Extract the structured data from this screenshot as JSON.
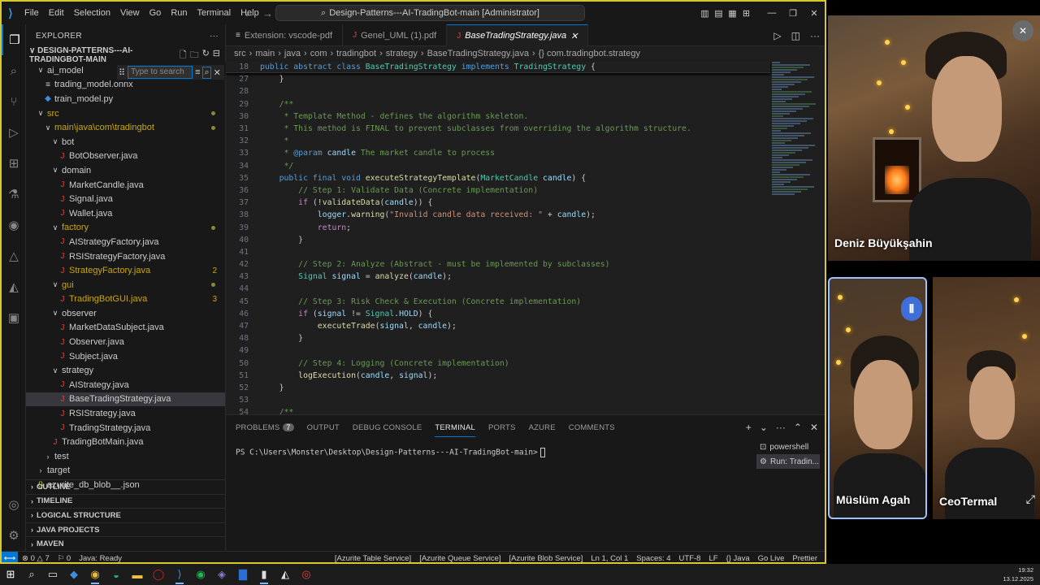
{
  "menu": [
    "File",
    "Edit",
    "Selection",
    "View",
    "Go",
    "Run",
    "Terminal",
    "Help"
  ],
  "command_center": "Design-Patterns---AI-TradingBot-main [Administrator]",
  "explorer": {
    "title": "EXPLORER",
    "root": "DESIGN-PATTERNS---AI-TRADINGBOT-MAIN",
    "search_placeholder": "Type to search",
    "rows": [
      {
        "label": "ai_model",
        "indent": 1,
        "kind": "folder-open",
        "color": "#cccccc"
      },
      {
        "label": "trading_model.onnx",
        "indent": 2,
        "kind": "file",
        "icon": "≡",
        "color": "#cccccc"
      },
      {
        "label": "train_model.py",
        "indent": 2,
        "kind": "file",
        "icon": "◆",
        "iconColor": "#3b8fe0",
        "color": "#cccccc"
      },
      {
        "label": "src",
        "indent": 1,
        "kind": "folder-open",
        "color": "#cca700",
        "dot": true
      },
      {
        "label": "main\\java\\com\\tradingbot",
        "indent": 2,
        "kind": "folder-open",
        "color": "#cca700",
        "dot": true
      },
      {
        "label": "bot",
        "indent": 3,
        "kind": "folder-open",
        "color": "#cccccc"
      },
      {
        "label": "BotObserver.java",
        "indent": 4,
        "kind": "file",
        "icon": "J",
        "iconColor": "#e04040",
        "color": "#cccccc"
      },
      {
        "label": "domain",
        "indent": 3,
        "kind": "folder-open",
        "color": "#cccccc"
      },
      {
        "label": "MarketCandle.java",
        "indent": 4,
        "kind": "file",
        "icon": "J",
        "iconColor": "#e04040",
        "color": "#cccccc"
      },
      {
        "label": "Signal.java",
        "indent": 4,
        "kind": "file",
        "icon": "J",
        "iconColor": "#e04040",
        "color": "#cccccc"
      },
      {
        "label": "Wallet.java",
        "indent": 4,
        "kind": "file",
        "icon": "J",
        "iconColor": "#e04040",
        "color": "#cccccc"
      },
      {
        "label": "factory",
        "indent": 3,
        "kind": "folder-open",
        "color": "#cca700",
        "dot": true
      },
      {
        "label": "AIStrategyFactory.java",
        "indent": 4,
        "kind": "file",
        "icon": "J",
        "iconColor": "#e04040",
        "color": "#cccccc"
      },
      {
        "label": "RSIStrategyFactory.java",
        "indent": 4,
        "kind": "file",
        "icon": "J",
        "iconColor": "#e04040",
        "color": "#cccccc"
      },
      {
        "label": "StrategyFactory.java",
        "indent": 4,
        "kind": "file",
        "icon": "J",
        "iconColor": "#e04040",
        "color": "#cca700",
        "badge": "2"
      },
      {
        "label": "gui",
        "indent": 3,
        "kind": "folder-open",
        "color": "#cca700",
        "dot": true
      },
      {
        "label": "TradingBotGUI.java",
        "indent": 4,
        "kind": "file",
        "icon": "J",
        "iconColor": "#e04040",
        "color": "#cca700",
        "badge": "3"
      },
      {
        "label": "observer",
        "indent": 3,
        "kind": "folder-open",
        "color": "#cccccc"
      },
      {
        "label": "MarketDataSubject.java",
        "indent": 4,
        "kind": "file",
        "icon": "J",
        "iconColor": "#e04040",
        "color": "#cccccc"
      },
      {
        "label": "Observer.java",
        "indent": 4,
        "kind": "file",
        "icon": "J",
        "iconColor": "#e04040",
        "color": "#cccccc"
      },
      {
        "label": "Subject.java",
        "indent": 4,
        "kind": "file",
        "icon": "J",
        "iconColor": "#e04040",
        "color": "#cccccc"
      },
      {
        "label": "strategy",
        "indent": 3,
        "kind": "folder-open",
        "color": "#cccccc"
      },
      {
        "label": "AIStrategy.java",
        "indent": 4,
        "kind": "file",
        "icon": "J",
        "iconColor": "#e04040",
        "color": "#cccccc"
      },
      {
        "label": "BaseTradingStrategy.java",
        "indent": 4,
        "kind": "file",
        "icon": "J",
        "iconColor": "#e04040",
        "color": "#cccccc",
        "selected": true
      },
      {
        "label": "RSIStrategy.java",
        "indent": 4,
        "kind": "file",
        "icon": "J",
        "iconColor": "#e04040",
        "color": "#cccccc"
      },
      {
        "label": "TradingStrategy.java",
        "indent": 4,
        "kind": "file",
        "icon": "J",
        "iconColor": "#e04040",
        "color": "#cccccc"
      },
      {
        "label": "TradingBotMain.java",
        "indent": 3,
        "kind": "file",
        "icon": "J",
        "iconColor": "#e04040",
        "color": "#cccccc"
      },
      {
        "label": "test",
        "indent": 2,
        "kind": "folder-closed",
        "color": "#cccccc"
      },
      {
        "label": "target",
        "indent": 1,
        "kind": "folder-closed",
        "color": "#cccccc"
      },
      {
        "label": "azurite_db_blob__.json",
        "indent": 1,
        "kind": "file",
        "icon": "{}",
        "iconColor": "#cbcb41",
        "color": "#cccccc"
      }
    ],
    "sections": [
      "OUTLINE",
      "TIMELINE",
      "LOGICAL STRUCTURE",
      "JAVA PROJECTS",
      "MAVEN"
    ]
  },
  "tabs": [
    {
      "label": "Extension: vscode-pdf",
      "icon": "≡",
      "active": false
    },
    {
      "label": "Genel_UML (1).pdf",
      "icon": "J",
      "active": false
    },
    {
      "label": "BaseTradingStrategy.java",
      "icon": "J",
      "active": true,
      "close": "✕"
    }
  ],
  "breadcrumb": [
    "src",
    "main",
    "java",
    "com",
    "tradingbot",
    "strategy",
    "BaseTradingStrategy.java",
    "{} com.tradingbot.strategy"
  ],
  "code": {
    "sticky": {
      "n": "18",
      "tokens": [
        [
          "kw",
          "public abstract class "
        ],
        [
          "ty",
          "BaseTradingStrategy"
        ],
        [
          "kw",
          " implements "
        ],
        [
          "ty",
          "TradingStrategy"
        ],
        [
          "pl",
          " {"
        ]
      ]
    },
    "lines": [
      {
        "n": "27",
        "tokens": [
          [
            "pl",
            "    }"
          ]
        ]
      },
      {
        "n": "28",
        "tokens": []
      },
      {
        "n": "29",
        "tokens": [
          [
            "cm",
            "    /**"
          ]
        ]
      },
      {
        "n": "30",
        "tokens": [
          [
            "cm",
            "     * Template Method - defines the algorithm skeleton."
          ]
        ]
      },
      {
        "n": "31",
        "tokens": [
          [
            "cm",
            "     * This method is FINAL to prevent subclasses from overriding the algorithm structure."
          ]
        ]
      },
      {
        "n": "32",
        "tokens": [
          [
            "cm",
            "     *"
          ]
        ]
      },
      {
        "n": "33",
        "tokens": [
          [
            "cm",
            "     * "
          ],
          [
            "kw",
            "@param"
          ],
          [
            "var",
            " candle"
          ],
          [
            "cm",
            " The market candle to process"
          ]
        ]
      },
      {
        "n": "34",
        "tokens": [
          [
            "cm",
            "     */"
          ]
        ]
      },
      {
        "n": "35",
        "tokens": [
          [
            "kw",
            "    public final void "
          ],
          [
            "fn",
            "executeStrategyTemplate"
          ],
          [
            "pl",
            "("
          ],
          [
            "ty",
            "MarketCandle"
          ],
          [
            "var",
            " candle"
          ],
          [
            "pl",
            ") {"
          ]
        ]
      },
      {
        "n": "36",
        "tokens": [
          [
            "cm",
            "        // Step 1: Validate Data (Concrete implementation)"
          ]
        ]
      },
      {
        "n": "37",
        "tokens": [
          [
            "kw2",
            "        if"
          ],
          [
            "pl",
            " (!"
          ],
          [
            "fn",
            "validateData"
          ],
          [
            "pl",
            "("
          ],
          [
            "var",
            "candle"
          ],
          [
            "pl",
            ")) {"
          ]
        ]
      },
      {
        "n": "38",
        "tokens": [
          [
            "var",
            "            logger"
          ],
          [
            "pl",
            "."
          ],
          [
            "fn",
            "warning"
          ],
          [
            "pl",
            "("
          ],
          [
            "str",
            "\"Invalid candle data received: \""
          ],
          [
            "pl",
            " + "
          ],
          [
            "var",
            "candle"
          ],
          [
            "pl",
            ");"
          ]
        ]
      },
      {
        "n": "39",
        "tokens": [
          [
            "kw2",
            "            return"
          ],
          [
            "pl",
            ";"
          ]
        ]
      },
      {
        "n": "40",
        "tokens": [
          [
            "pl",
            "        }"
          ]
        ]
      },
      {
        "n": "41",
        "tokens": []
      },
      {
        "n": "42",
        "tokens": [
          [
            "cm",
            "        // Step 2: Analyze (Abstract - must be implemented by subclasses)"
          ]
        ]
      },
      {
        "n": "43",
        "tokens": [
          [
            "ty",
            "        Signal"
          ],
          [
            "var",
            " signal"
          ],
          [
            "pl",
            " = "
          ],
          [
            "fn",
            "analyze"
          ],
          [
            "pl",
            "("
          ],
          [
            "var",
            "candle"
          ],
          [
            "pl",
            ");"
          ]
        ]
      },
      {
        "n": "44",
        "tokens": []
      },
      {
        "n": "45",
        "tokens": [
          [
            "cm",
            "        // Step 3: Risk Check & Execution (Concrete implementation)"
          ]
        ]
      },
      {
        "n": "46",
        "tokens": [
          [
            "kw2",
            "        if"
          ],
          [
            "pl",
            " ("
          ],
          [
            "var",
            "signal"
          ],
          [
            "pl",
            " != "
          ],
          [
            "ty",
            "Signal"
          ],
          [
            "pl",
            "."
          ],
          [
            "var",
            "HOLD"
          ],
          [
            "pl",
            ") {"
          ]
        ]
      },
      {
        "n": "47",
        "tokens": [
          [
            "fn",
            "            executeTrade"
          ],
          [
            "pl",
            "("
          ],
          [
            "var",
            "signal"
          ],
          [
            "pl",
            ", "
          ],
          [
            "var",
            "candle"
          ],
          [
            "pl",
            ");"
          ]
        ]
      },
      {
        "n": "48",
        "tokens": [
          [
            "pl",
            "        }"
          ]
        ]
      },
      {
        "n": "49",
        "tokens": []
      },
      {
        "n": "50",
        "tokens": [
          [
            "cm",
            "        // Step 4: Logging (Concrete implementation)"
          ]
        ]
      },
      {
        "n": "51",
        "tokens": [
          [
            "fn",
            "        logExecution"
          ],
          [
            "pl",
            "("
          ],
          [
            "var",
            "candle"
          ],
          [
            "pl",
            ", "
          ],
          [
            "var",
            "signal"
          ],
          [
            "pl",
            ");"
          ]
        ]
      },
      {
        "n": "52",
        "tokens": [
          [
            "pl",
            "    }"
          ]
        ]
      },
      {
        "n": "53",
        "tokens": []
      },
      {
        "n": "54",
        "tokens": [
          [
            "cm",
            "    /**"
          ]
        ]
      }
    ]
  },
  "panel": {
    "tabs": [
      {
        "label": "PROBLEMS",
        "badge": "7"
      },
      {
        "label": "OUTPUT"
      },
      {
        "label": "DEBUG CONSOLE"
      },
      {
        "label": "TERMINAL",
        "active": true
      },
      {
        "label": "PORTS"
      },
      {
        "label": "AZURE"
      },
      {
        "label": "COMMENTS"
      }
    ],
    "prompt": "PS C:\\Users\\Monster\\Desktop\\Design-Patterns---AI-TradingBot-main>",
    "terminals": [
      "powershell",
      "Run: Tradin..."
    ]
  },
  "status": {
    "left": [
      "⊗ 0 △ 7",
      "⚐ 0",
      "Java: Ready"
    ],
    "right": [
      "[Azurite Table Service]",
      "[Azurite Queue Service]",
      "[Azurite Blob Service]",
      "Ln 1, Col 1",
      "Spaces: 4",
      "UTF-8",
      "LF",
      "{} Java",
      "Go Live",
      "Prettier"
    ]
  },
  "clock": {
    "time": "19:32",
    "date": "13.12.2025"
  },
  "participants": [
    {
      "name": "Deniz Büyükşahin"
    },
    {
      "name": "Müslüm Agah"
    },
    {
      "name": "CeoTermal"
    }
  ],
  "colors": {
    "accent": "#0078d4",
    "modified": "#cca700",
    "window_border": "#d7c92a",
    "speaker_border": "#9ec2ff"
  }
}
